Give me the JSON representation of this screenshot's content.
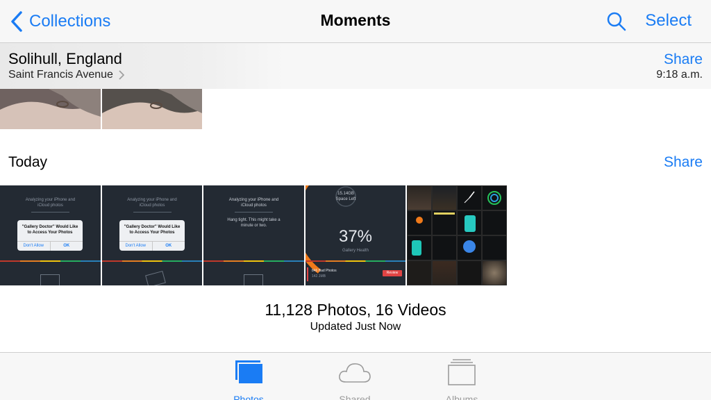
{
  "nav": {
    "back_label": "Collections",
    "title": "Moments",
    "select_label": "Select"
  },
  "moment1": {
    "location": "Solihull, England",
    "sublocation": "Saint Francis Avenue",
    "share_label": "Share",
    "time": "9:18 a.m."
  },
  "moment2": {
    "title": "Today",
    "share_label": "Share",
    "shots": {
      "analyzing": "Analyzing your iPhone and iCloud photos",
      "dialog_title": "\"Gallery Doctor\" Would Like to Access Your Photos",
      "dont_allow": "Don't Allow",
      "ok": "OK",
      "hang_tight": "Hang tight. This might take a minute or two.",
      "space_value": "15.14GB",
      "space_label": "Space Left",
      "health_value": "37%",
      "health_label": "Gallery Health",
      "bad_photos": "846 Bad Photos",
      "bad_size": "142.1MB",
      "review": "Review"
    }
  },
  "summary": {
    "counts": "11,128 Photos, 16 Videos",
    "updated": "Updated Just Now"
  },
  "tabs": [
    {
      "label": "Photos",
      "active": true
    },
    {
      "label": "Shared",
      "active": false
    },
    {
      "label": "Albums",
      "active": false
    }
  ],
  "colors": {
    "accent": "#1a7cf4",
    "inactive_tab": "#9b9b9b",
    "health_orange": "#f07a1a",
    "review_red": "#e04444"
  }
}
